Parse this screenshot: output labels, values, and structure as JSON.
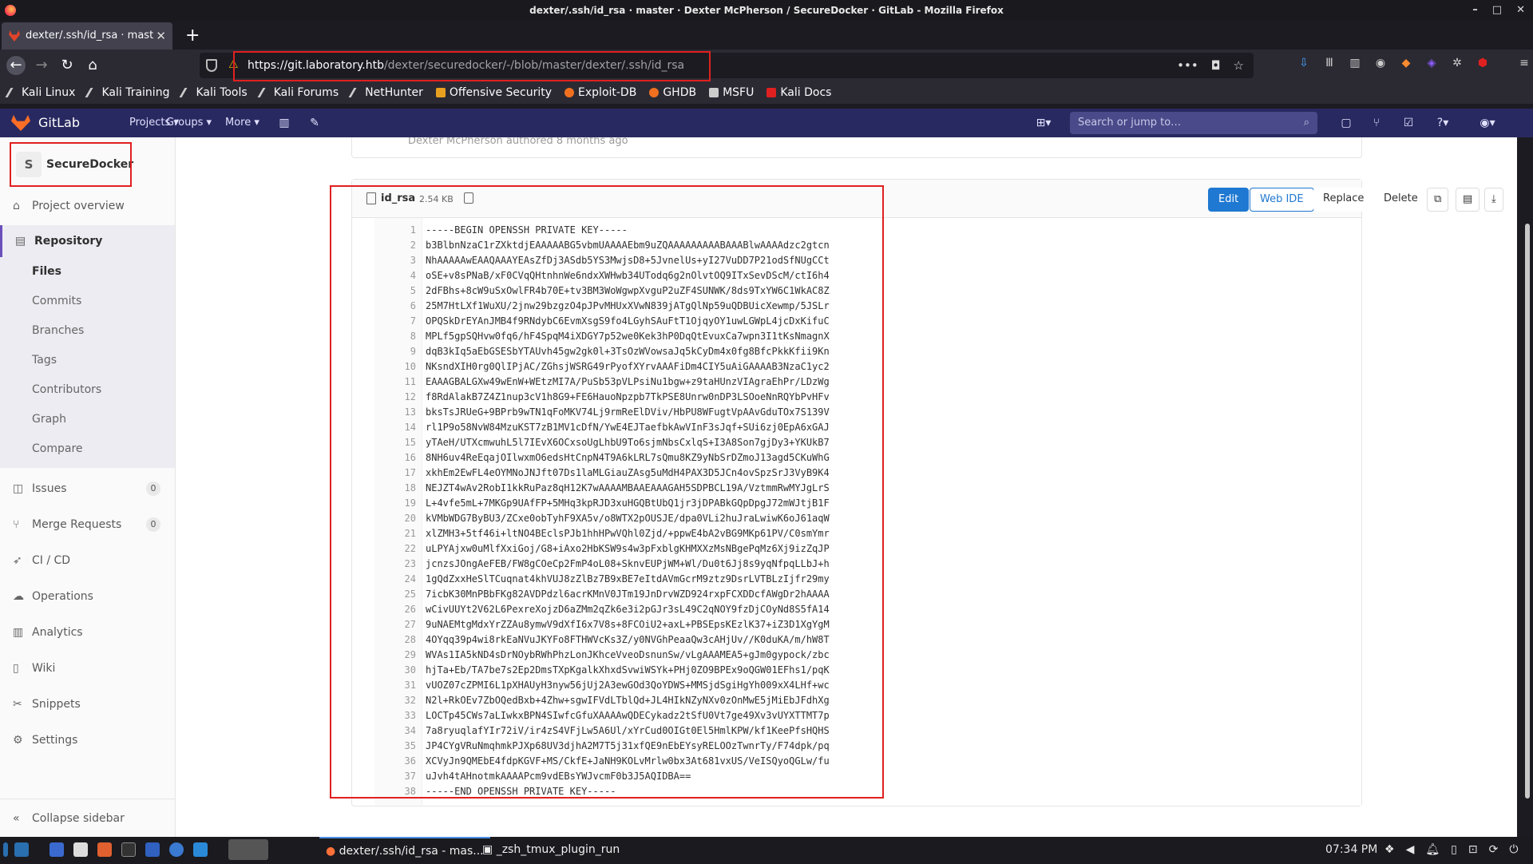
{
  "window": {
    "title": "dexter/.ssh/id_rsa · master · Dexter McPherson / SecureDocker · GitLab - Mozilla Firefox",
    "controls": [
      "–",
      "□",
      "✕"
    ]
  },
  "browser": {
    "tab_title": "dexter/.ssh/id_rsa · mast",
    "url_host": "https://git.laboratory.htb",
    "url_path": "/dexter/securedocker/-/blob/master/dexter/.ssh/id_rsa",
    "new_tab": "+"
  },
  "bookmarks": [
    {
      "label": "Kali Linux",
      "color": "#cccccc"
    },
    {
      "label": "Kali Training",
      "color": "#cccccc"
    },
    {
      "label": "Kali Tools",
      "color": "#cccccc"
    },
    {
      "label": "Kali Forums",
      "color": "#cccccc"
    },
    {
      "label": "NetHunter",
      "color": "#cccccc"
    },
    {
      "label": "Offensive Security",
      "color": "#e8a020"
    },
    {
      "label": "Exploit-DB",
      "color": "#f07020"
    },
    {
      "label": "GHDB",
      "color": "#f07020"
    },
    {
      "label": "MSFU",
      "color": "#cccccc"
    },
    {
      "label": "Kali Docs",
      "color": "#e02020"
    }
  ],
  "gitlab": {
    "brand": "GitLab",
    "nav": [
      "Projects",
      "Groups",
      "More"
    ],
    "search_placeholder": "Search or jump to…"
  },
  "sidebar": {
    "project_initial": "S",
    "project_name": "SecureDocker",
    "items": [
      {
        "label": "Project overview",
        "icon": "home-icon"
      },
      {
        "label": "Repository",
        "icon": "doc-icon"
      },
      {
        "label": "Issues",
        "icon": "issues-icon",
        "count": "0"
      },
      {
        "label": "Merge Requests",
        "icon": "merge-icon",
        "count": "0"
      },
      {
        "label": "CI / CD",
        "icon": "rocket-icon"
      },
      {
        "label": "Operations",
        "icon": "cloud-icon"
      },
      {
        "label": "Analytics",
        "icon": "chart-icon"
      },
      {
        "label": "Wiki",
        "icon": "book-icon"
      },
      {
        "label": "Snippets",
        "icon": "scissors-icon"
      },
      {
        "label": "Settings",
        "icon": "gear-icon"
      }
    ],
    "repo_sub": [
      "Files",
      "Commits",
      "Branches",
      "Tags",
      "Contributors",
      "Graph",
      "Compare"
    ],
    "collapse": "Collapse sidebar"
  },
  "commit": {
    "author_line": "Dexter McPherson authored 8 months ago"
  },
  "file": {
    "name": "id_rsa",
    "size": "2.54 KB",
    "buttons": {
      "edit": "Edit",
      "webide": "Web IDE",
      "replace": "Replace",
      "delete": "Delete"
    },
    "lines": [
      "-----BEGIN OPENSSH PRIVATE KEY-----",
      "b3BlbnNzaC1rZXktdjEAAAAABG5vbmUAAAAEbm9uZQAAAAAAAAABAAABlwAAAAdzc2gtcn",
      "NhAAAAAwEAAQAAAYEAsZfDj3ASdb5YS3MwjsD8+5JvnelUs+yI27VuDD7P21odSfNUgCCt",
      "oSE+v8sPNaB/xF0CVqQHtnhnWe6ndxXWHwb34UTodq6g2nOlvtOQ9ITxSevDScM/ctI6h4",
      "2dFBhs+8cW9uSxOwlFR4b70E+tv3BM3WoWgwpXvguP2uZF4SUNWK/8ds9TxYW6C1WkAC8Z",
      "25M7HtLXf1WuXU/2jnw29bzgzO4pJPvMHUxXVwN839jATgQlNp59uQDBUicXewmp/5JSLr",
      "OPQSkDrEYAnJMB4f9RNdybC6EvmXsgS9fo4LGyhSAuFtT1OjqyOY1uwLGWpL4jcDxKifuC",
      "MPLf5gpSQHvw0fq6/hF4SpqM4iXDGY7p52we0Kek3hP0DqQtEvuxCa7wpn3I1tKsNmagnX",
      "dqB3kIq5aEbGSESbYTAUvh45gw2gk0l+3TsOzWVowsaJq5kCyDm4x0fg8BfcPkkKfii9Kn",
      "NKsndXIH0rg0QlIPjAC/ZGhsjWSRG49rPyofXYrvAAAFiDm4CIY5uAiGAAAAB3NzaC1yc2",
      "EAAAGBALGXw49wEnW+WEtzMI7A/PuSb53pVLPsiNu1bgw+z9taHUnzVIAgraEhPr/LDzWg",
      "f8RdAlakB7Z4Z1nup3cV1h8G9+FE6HauoNpzpb7TkPSE8Unrw0nDP3LSOoeNnRQYbPvHFv",
      "bksTsJRUeG+9BPrb9wTN1qFoMKV74Lj9rmReElDViv/HbPU8WFugtVpAAvGduTOx7S139V",
      "rl1P9o58NvW84MzuKST7zB1MV1cDfN/YwE4EJTaefbkAwVInF3sJqf+SUi6zj0EpA6xGAJ",
      "yTAeH/UTXcmwuhL5l7IEvX6OCxsoUgLhbU9To6sjmNbsCxlqS+I3A8Son7gjDy3+YKUkB7",
      "8NH6uv4ReEqajOIlwxmO6edsHtCnpN4T9A6kLRL7sQmu8KZ9yNbSrDZmoJ13agd5CKuWhG",
      "xkhEm2EwFL4eOYMNoJNJft07Ds1laMLGiauZAsg5uMdH4PAX3D5JCn4ovSpzSrJ3VyB9K4",
      "NEJZT4wAv2RobI1kkRuPaz8qH12K7wAAAAMBAAEAAAGAH5SDPBCL19A/VztmmRwMYJgLrS",
      "L+4vfe5mL+7MKGp9UAfFP+5MHq3kpRJD3xuHGQBtUbQ1jr3jDPABkGQpDpgJ72mWJtjB1F",
      "kVMbWDG7ByBU3/ZCxe0obTyhF9XA5v/o8WTX2pOUSJE/dpa0VLi2huJraLwiwK6oJ61aqW",
      "xlZMH3+5tf46i+ltNO4BEclsPJb1hhHPwVQhl0Zjd/+ppwE4bA2vBG9MKp61PV/C0smYmr",
      "uLPYAjxw0uMlfXxiGoj/G8+iAxo2HbKSW9s4w3pFxblgKHMXXzMsNBgePqMz6Xj9izZqJP",
      "jcnzsJOngAeFEB/FW8gCOeCp2FmP4oL08+SknvEUPjWM+Wl/Du0t6Jj8s9yqNfpqLLbJ+h",
      "1gQdZxxHeSlTCuqnat4khVUJ8zZlBz7B9xBE7eItdAVmGcrM9ztz9DsrLVTBLzIjfr29my",
      "7icbK30MnPBbFKg82AVDPdzl6acrKMnV0JTm19JnDrvWZD924rxpFCXDDcfAWgDr2hAAAA",
      "wCivUUYt2V62L6PexreXojzD6aZMm2qZk6e3i2pGJr3sL49C2qNOY9fzDjCOyNd8S5fA14",
      "9uNAEMtgMdxYrZZAu8ymwV9dXfI6x7V8s+8FCOiU2+axL+PBSEpsKEzlK37+iZ3D1XgYgM",
      "4OYqq39p4wi8rkEaNVuJKYFo8FTHWVcKs3Z/y0NVGhPeaaQw3cAHjUv//K0duKA/m/hW8T",
      "WVAs1IA5kND4sDrNOybRWhPhzLonJKhceVveoDsnunSw/vLgAAAMEA5+gJm0gypock/zbc",
      "hjTa+Eb/TA7be7s2Ep2DmsTXpKgalkXhxdSvwiWSYk+PHj0ZO9BPEx9oQGW01EFhs1/pqK",
      "vUOZ07cZPMI6L1pXHAUyH3nyw56jUj2A3ewGOd3QoYDWS+MMSjdSgiHgYh009xX4LHf+wc",
      "N2l+RkOEv7ZbOQedBxb+4Zhw+sgwIFVdLTblQd+JL4HIkNZyNXv0zOnMwE5jMiEbJFdhXg",
      "LOCTp45CWs7aLIwkxBPN4SIwfcGfuXAAAAwQDECykadz2tSfU0Vt7ge49Xv3vUYXTTMT7p",
      "7a8ryuqlafYIr72iV/ir4zS4VFjLw5A6Ul/xYrCud0OIGt0El5HmlKPW/kf1KeePfsHQHS",
      "JP4CYgVRuNmqhmkPJXp68UV3djhA2M7T5j31xfQE9nEbEYsyRELOOzTwnrTy/F74dpk/pq",
      "XCVyJn9QMEbE4fdpKGVF+MS/CkfE+JaNH9KOLvMrlw0bx3At681vxUS/VeISQyoQGLw/fu",
      "uJvh4tAHnotmkAAAAPcm9vdEBsYWJvcmF0b3J5AQIDBA==",
      "-----END OPENSSH PRIVATE KEY-----"
    ]
  },
  "taskbar": {
    "apps": [
      {
        "label": "dexter/.ssh/id_rsa - mas..."
      },
      {
        "label": "_zsh_tmux_plugin_run"
      }
    ],
    "clock": "07:34 PM"
  },
  "colors": {
    "gitlab_header": "#292961",
    "primary": "#1f78d1",
    "highlight": "#e02020",
    "sidebar_accent": "#6b4fbb"
  }
}
